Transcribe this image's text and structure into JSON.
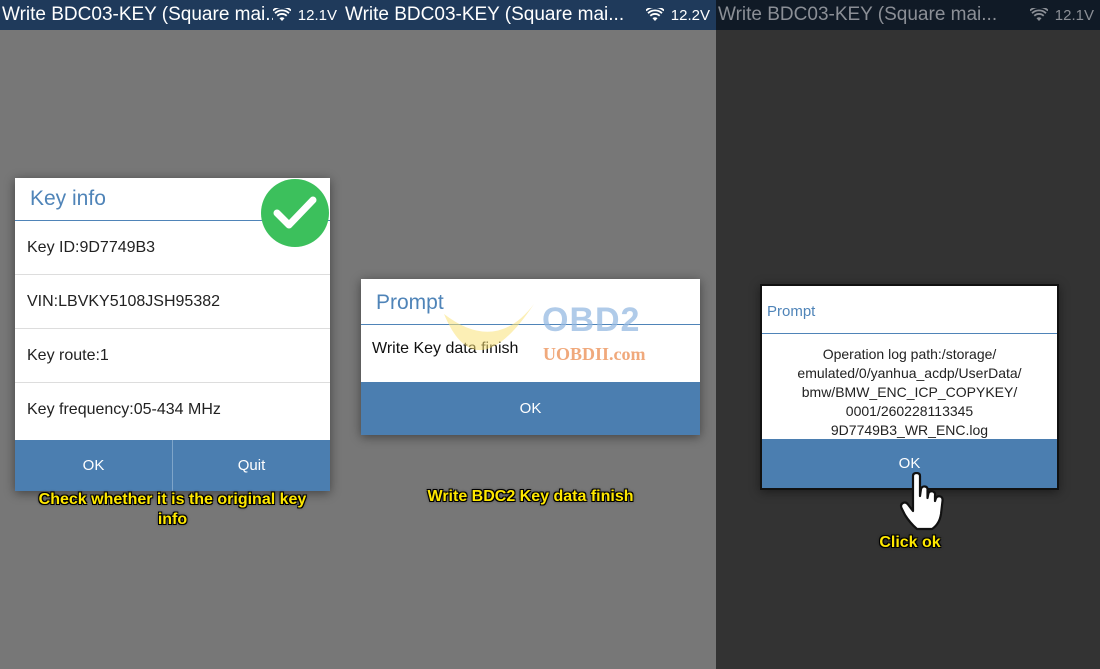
{
  "panels": [
    {
      "status_title": "Write BDC03-KEY (Square mai...",
      "status_voltage": "12.1V",
      "dialog": {
        "title": "Key info",
        "rows": [
          "Key ID:9D7749B3",
          "VIN:LBVKY5108JSH95382",
          "Key route:1",
          "Key frequency:05-434 MHz"
        ],
        "ok_label": "OK",
        "quit_label": "Quit"
      },
      "caption": "Check whether it is the original key info",
      "icon": "check-circle-icon"
    },
    {
      "status_title": "Write BDC03-KEY (Square mai...",
      "status_voltage": "12.2V",
      "dialog": {
        "title": "Prompt",
        "message": "Write Key data finish",
        "ok_label": "OK"
      },
      "caption": "Write BDC2 Key data finish",
      "watermark": {
        "brand": "OBD2",
        "url": "UOBDII.com"
      }
    },
    {
      "status_title": "Write BDC03-KEY (Square mai...",
      "status_voltage": "12.1V",
      "dialog": {
        "title": "Prompt",
        "message_lines": [
          "Operation log path:/storage/",
          "emulated/0/yanhua_acdp/UserData/",
          "bmw/BMW_ENC_ICP_COPYKEY/",
          "0001/260228113345",
          "9D7749B3_WR_ENC.log"
        ],
        "ok_label": "OK"
      },
      "caption": "Click ok",
      "icon": "pointing-hand-icon"
    }
  ],
  "colors": {
    "status_bar": "#1f3a5b",
    "accent_blue": "#4b7eb0",
    "title_blue": "#4f84b8",
    "caption_yellow": "#ffe800",
    "check_green": "#3cc05c"
  }
}
